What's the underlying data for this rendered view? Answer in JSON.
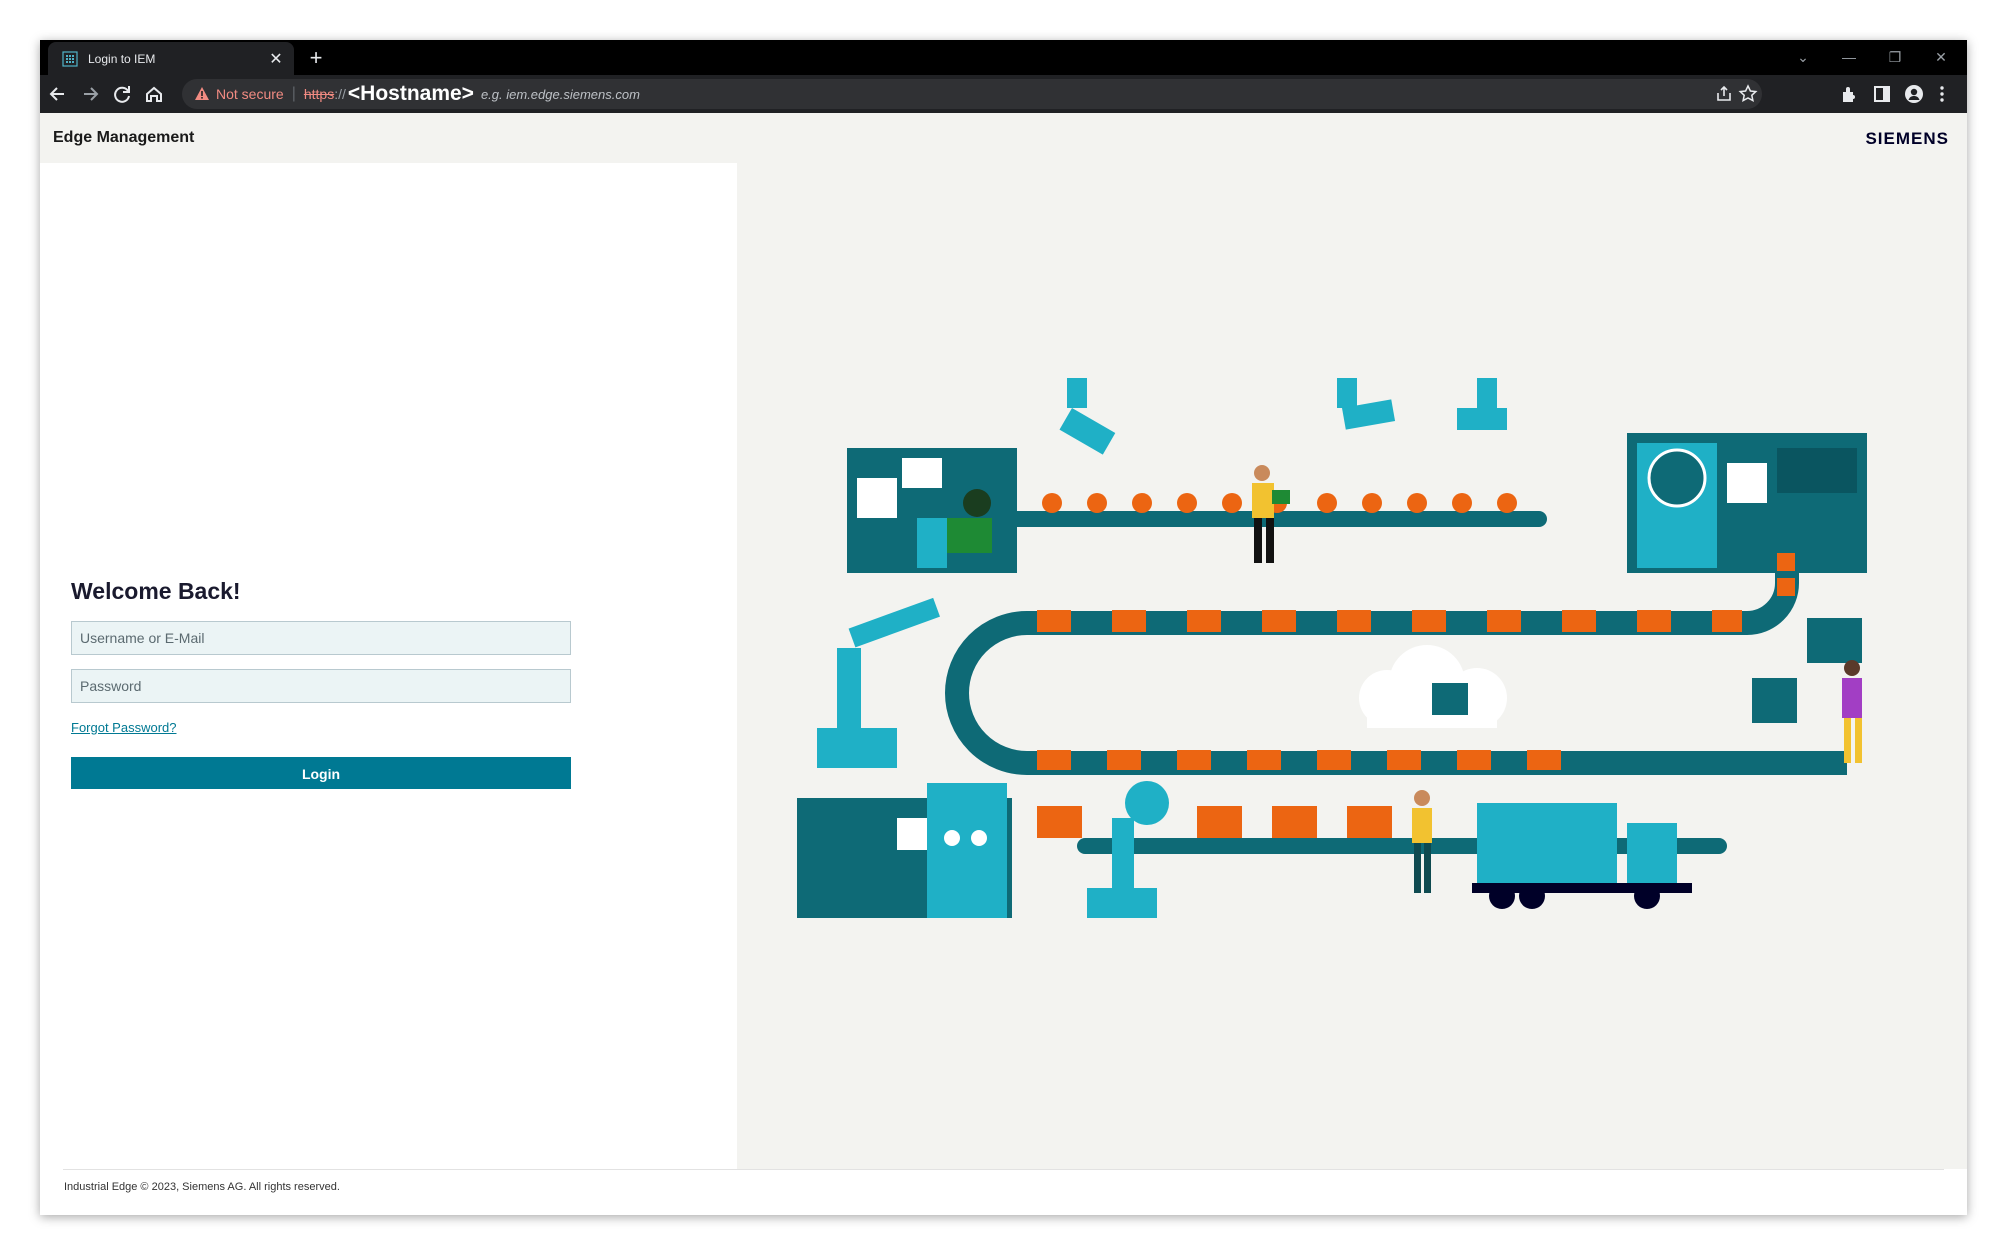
{
  "browser": {
    "tab_title": "Login to IEM",
    "new_tab_symbol": "+",
    "omnibox": {
      "security_label": "Not secure",
      "separator": "|",
      "protocol": "https",
      "slashes": "://",
      "host": "<Hostname>",
      "hint": "e.g. iem.edge.siemens.com"
    },
    "icons": [
      "favicon-grid-icon",
      "close-icon",
      "new-tab-icon",
      "back-icon",
      "forward-icon",
      "reload-icon",
      "home-icon",
      "warning-icon",
      "share-icon",
      "star-icon",
      "extensions-icon",
      "side-panel-icon",
      "profile-icon",
      "menu-icon",
      "chevron-down-icon",
      "minimize-icon",
      "restore-icon",
      "window-close-icon"
    ]
  },
  "header": {
    "app_name": "Edge Management",
    "brand": "SIEMENS"
  },
  "login": {
    "heading": "Welcome Back!",
    "username_placeholder": "Username or E-Mail",
    "password_placeholder": "Password",
    "forgot_label": "Forgot Password?",
    "login_label": "Login"
  },
  "footer": {
    "copyright": "Industrial Edge © 2023, Siemens AG. All rights reserved."
  },
  "colors": {
    "accent": "#007993",
    "teal_dark": "#0e6a76",
    "teal_light": "#1fb0c6",
    "orange": "#ec6512",
    "brand_navy": "#000028",
    "panel_bg": "#f3f3f0",
    "input_bg": "#ebf4f5"
  }
}
